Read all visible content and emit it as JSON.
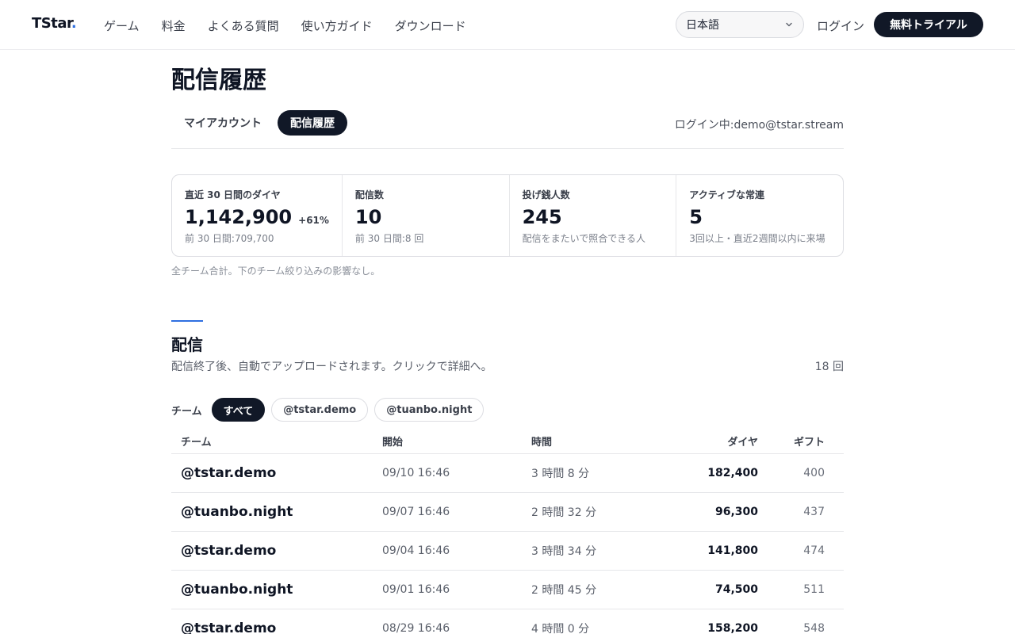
{
  "header": {
    "logo": "TStar",
    "logo_dot": ".",
    "nav": [
      "ゲーム",
      "料金",
      "よくある質問",
      "使い方ガイド",
      "ダウンロード"
    ],
    "language": "日本語",
    "login": "ログイン",
    "trial": "無料トライアル"
  },
  "page": {
    "title": "配信履歴",
    "tabs": [
      "マイアカウント",
      "配信履歴"
    ],
    "login_status": "ログイン中:demo@tstar.stream"
  },
  "stats": [
    {
      "label": "直近 30 日間のダイヤ",
      "value": "1,142,900",
      "delta": "+61%",
      "sub": "前 30 日間:709,700"
    },
    {
      "label": "配信数",
      "value": "10",
      "delta": "",
      "sub": "前 30 日間:8 回"
    },
    {
      "label": "投げ銭人数",
      "value": "245",
      "delta": "",
      "sub": "配信をまたいで照合できる人"
    },
    {
      "label": "アクティブな常連",
      "value": "5",
      "delta": "",
      "sub": "3回以上・直近2週間以内に来場"
    }
  ],
  "stats_note": "全チーム合計。下のチーム絞り込みの影響なし。",
  "section": {
    "title": "配信",
    "description": "配信終了後、自動でアップロードされます。クリックで詳細へ。",
    "count": "18 回"
  },
  "filter": {
    "label": "チーム",
    "chips": [
      "すべて",
      "@tstar.demo",
      "@tuanbo.night"
    ]
  },
  "table": {
    "headers": [
      "チーム",
      "開始",
      "時間",
      "ダイヤ",
      "ギフト"
    ],
    "rows": [
      [
        "@tstar.demo",
        "09/10 16:46",
        "3 時間 8 分",
        "182,400",
        "400"
      ],
      [
        "@tuanbo.night",
        "09/07 16:46",
        "2 時間 32 分",
        "96,300",
        "437"
      ],
      [
        "@tstar.demo",
        "09/04 16:46",
        "3 時間 34 分",
        "141,800",
        "474"
      ],
      [
        "@tuanbo.night",
        "09/01 16:46",
        "2 時間 45 分",
        "74,500",
        "511"
      ],
      [
        "@tstar.demo",
        "08/29 16:46",
        "4 時間 0 分",
        "158,200",
        "548"
      ]
    ]
  },
  "colors": {
    "accent": "#2f6fe0",
    "dark": "#111827"
  }
}
